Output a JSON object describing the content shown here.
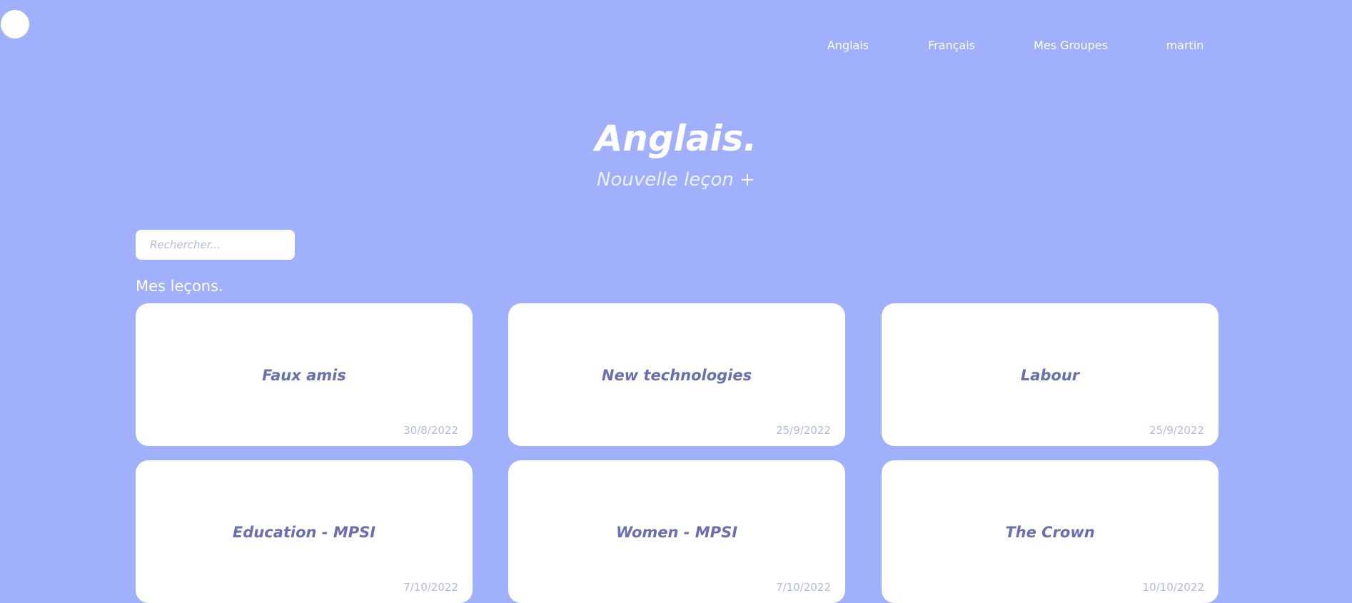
{
  "header": {
    "logo_icon": "circle-logo-icon",
    "nav": [
      {
        "label": "Anglais"
      },
      {
        "label": "Français"
      },
      {
        "label": "Mes Groupes"
      },
      {
        "label": "martin"
      }
    ]
  },
  "hero": {
    "title": "Anglais.",
    "new_lesson_label": "Nouvelle leçon +"
  },
  "search": {
    "placeholder": "Rechercher..."
  },
  "lessons": {
    "section_title": "Mes leçons.",
    "cards": [
      {
        "title": "Faux amis",
        "date": "30/8/2022"
      },
      {
        "title": "New technologies",
        "date": "25/9/2022"
      },
      {
        "title": "Labour",
        "date": "25/9/2022"
      },
      {
        "title": "Education - MPSI",
        "date": "7/10/2022"
      },
      {
        "title": "Women - MPSI",
        "date": "7/10/2022"
      },
      {
        "title": "The Crown",
        "date": "10/10/2022"
      }
    ]
  },
  "colors": {
    "background": "#a0b0fd",
    "card": "#ffffff",
    "card_title": "#6970ad",
    "card_date": "#b4bbd8"
  }
}
